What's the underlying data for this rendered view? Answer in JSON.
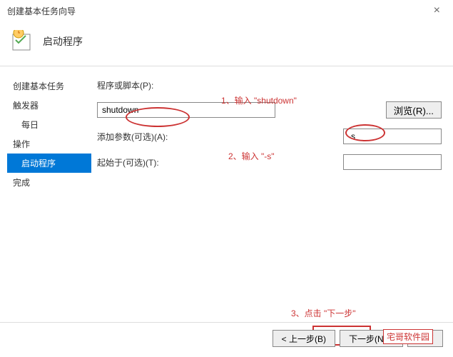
{
  "window": {
    "title": "创建基本任务向导",
    "close": "×"
  },
  "header": {
    "title": "启动程序"
  },
  "sidebar": {
    "item1": "创建基本任务",
    "item2": "触发器",
    "sub2": "每日",
    "item3": "操作",
    "sub3": "启动程序",
    "item4": "完成"
  },
  "form": {
    "programLabel": "程序或脚本(P):",
    "programValue": "shutdown",
    "browseLabel": "浏览(R)...",
    "paramLabel": "添加参数(可选)(A):",
    "paramValue": "-s",
    "startLabel": "起始于(可选)(T):",
    "startValue": ""
  },
  "annotations": {
    "a1": "1、输入 \"shutdown\"",
    "a2": "2、输入 \"-s\"",
    "a3": "3、点击 \"下一步\""
  },
  "buttons": {
    "back": "< 上一步(B)",
    "next": "下一步(N) >",
    "cancel": "取消"
  },
  "watermark": "宅哥软件园"
}
